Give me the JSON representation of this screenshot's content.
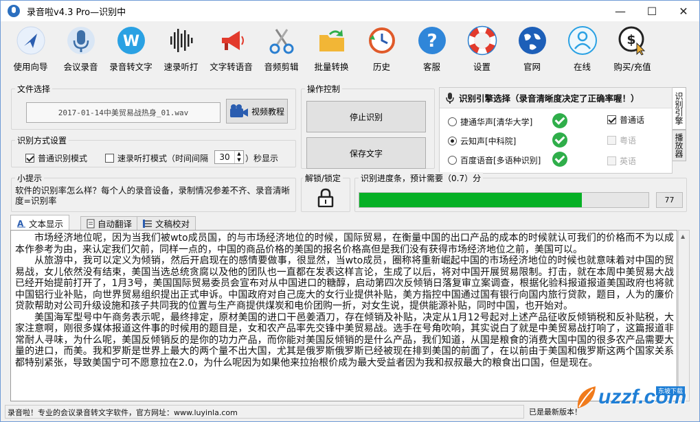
{
  "window": {
    "title": "录音啦v4.3 Pro—识别中",
    "minimize": "—",
    "maximize": "☐",
    "close": "✕"
  },
  "toolbar": [
    {
      "label": "使用向导",
      "icon": "navigation-arrow-icon"
    },
    {
      "label": "会议录音",
      "icon": "microphone-icon"
    },
    {
      "label": "录音转文字",
      "icon": "w-letter-icon"
    },
    {
      "label": "速录听打",
      "icon": "soundwave-icon"
    },
    {
      "label": "文字转语音",
      "icon": "megaphone-icon"
    },
    {
      "label": "音频剪辑",
      "icon": "scissors-icon"
    },
    {
      "label": "批量转换",
      "icon": "folder-convert-icon"
    },
    {
      "label": "历史",
      "icon": "history-clock-icon"
    },
    {
      "label": "客服",
      "icon": "question-icon"
    },
    {
      "label": "设置",
      "icon": "lifebuoy-icon"
    },
    {
      "label": "官网",
      "icon": "globe-icon"
    },
    {
      "label": "在线",
      "icon": "user-online-icon"
    },
    {
      "label": "购买/充值",
      "icon": "dollar-cursor-icon"
    }
  ],
  "file_select": {
    "group_label": "文件选择",
    "file_name": "2017-01-14中美贸易战热身_01.wav",
    "video_button": "视频教程"
  },
  "recognition_mode": {
    "group_label": "识别方式设置",
    "normal_mode": "普通识别模式",
    "normal_checked": true,
    "dictation_mode": "速录听打模式（时间间隔",
    "dictation_checked": false,
    "interval_value": "30",
    "interval_suffix": "）秒显示"
  },
  "operation": {
    "group_label": "操作控制",
    "stop_button": "停止识别",
    "save_button": "保存文字"
  },
  "engine": {
    "title": "识别引擎选择（录音清晰度决定了正确率喔！）",
    "options": [
      {
        "label": "捷通华声[清华大学]",
        "selected": false
      },
      {
        "label": "云知声[中科院]",
        "selected": true
      },
      {
        "label": "百度语音[多语种识别]",
        "selected": false
      }
    ],
    "languages": [
      {
        "label": "普通话",
        "checked": true,
        "enabled": true
      },
      {
        "label": "粤语",
        "checked": false,
        "enabled": false
      },
      {
        "label": "英语",
        "checked": false,
        "enabled": false
      }
    ],
    "side_tab_1": "识别引擎",
    "side_tab_2": "播放器"
  },
  "tips": {
    "group_label": "小提示",
    "text": "软件的识别率怎么样？每个人的录音设备，录制情况参差不齐、录音清晰度=识别率"
  },
  "lock": {
    "label": "解锁/锁定"
  },
  "progress": {
    "label": "识别进度条，预计需要（0.7）分",
    "percent": 77,
    "display": "77"
  },
  "tabs": [
    {
      "label": "文本显示",
      "icon": "text-display-icon",
      "active": true
    },
    {
      "label": "自动翻译",
      "icon": "translate-icon",
      "active": false
    },
    {
      "label": "文稿校对",
      "icon": "proofread-icon",
      "active": false
    }
  ],
  "text_content": [
    "市场经济地位呢，因为当我们被wto成员国，的与市场经济地位的时候，国际贸易，在衡量中国的出口产品的成本的时候就认可我们的价格而不为以成本作参考为由，来认定我们欠前，同样一点的，中国的商品价格的美国的报名价格高但是我们没有获得市场经济地位之前，美国可以。",
    "从旅游中，我可以定义为倾销，然后开启现在的感情要做事，很显然，当wto成员，圈称将重新崛起中国的市场经济地位的时候也就意味着对中国的贸易战，女儿依然没有结束，美国当选总统贪腐以及他的团队也一直都在发表这样言论，生成了以后，将对中国开展贸易限制。打击，就在本周中美贸易大战已经开始提前打开了，1月3号，美国国际贸易委员会宣布对从中国进口的糖醇，启动第四次反倾销日落复审立案调查，根据化验科报道报道美国政府也将就中国铝行业补贴，向世界贸易组织提出正式申诉。中国政府对自己庞大的女行业提供补贴，美方指控中国通过国有银行向国内旅行贷款，题目，人为的廉价贷款帮助对公司升级设施和孩子共同我的位置与生产商提供煤炭和电价团购一折，对女生说，提供能源补贴，同时中国，也开始对。",
    "美国海军型号中午商务表示呢，最终排定，原材美国的进口干邑姜酒刀，存在倾销及补贴，决定从1月12号起对上述产品征收反倾销税和反补贴税，大家注意啊，刚很多媒体报道这件事的时候用的题目是，女和农产品率先交锋中美贸易战。选手在号角吹响，其实说白了就是中美贸易战打响了，这篇报道非常耐人寻味，为什么呢，美国反倾销反的是你的功力产品，而你能对美国反倾销的是什么产品，我们知道，从国是粮食的消费大国中国的很多农产品需要大量的进口，而美。我和罗斯是世界上最大的两个量不出大国，尤其是俄罗斯俄罗斯已经被现在排到美国的前面了，在以前由于美国和俄罗斯这两个国家关系都特别紧张，导致美国宁可不愿意拉在2.0，为什么呢因为如果他来拉抬根价成为最大受益者因为我和叔叔最大的粮食出口国，但是现在。"
  ],
  "status": {
    "left": "录音啦！专业的会议录音转文字软件，官方网址：www.luyinla.com",
    "right": "已是最新版本！"
  },
  "watermark": {
    "text": "uzzf.com",
    "sub": "东坡下载"
  }
}
